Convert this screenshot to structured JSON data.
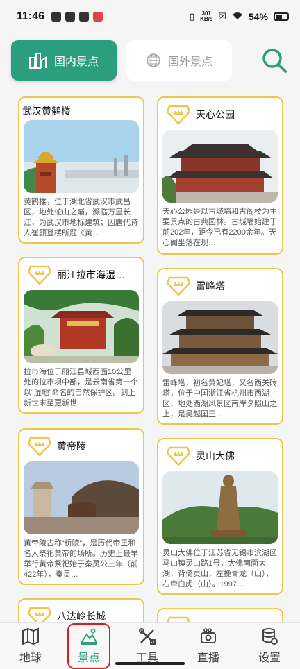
{
  "status": {
    "time": "11:46",
    "net_speed_value": "301",
    "net_speed_unit": "KB/s",
    "battery": "54%"
  },
  "tabs": {
    "domestic": "国内景点",
    "foreign": "国外景点"
  },
  "cards": [
    {
      "title": "武汉黄鹤楼",
      "desc": "黄鹤楼，位于湖北省武汉市武昌区，地处蛇山之巅，濒临万里长江，为武汉市地标建筑；因唐代诗人崔颢登楼所题《黄…"
    },
    {
      "title": "天心公园",
      "desc": "天心公园是以古城墙和古阁楼为主要景点的古典园林。古城墙始建于前202年，距今已有2200余年。天心阁坐落在现…"
    },
    {
      "title": "丽江拉市海湿…",
      "desc": "拉市海位于丽江县城西面10公里处的拉市坝中部，是云南省第一个以“湿地”命名的自然保护区。到上新世末至更新世…"
    },
    {
      "title": "雷峰塔",
      "desc": "雷峰塔，初名黄妃塔，又名西关砖塔，位于中国浙江省杭州市西湖区，地处西湖风景区南岸夕照山之上，是吴越国王…"
    },
    {
      "title": "黄帝陵",
      "desc": "黄帝陵古称“桥陵”，是历代帝王和名人祭祀黄帝的场所。历史上最早举行黄帝祭祀始于秦灵公三年（前422年），秦灵…"
    },
    {
      "title": "灵山大佛",
      "desc": "灵山大佛位于江苏省无锡市滨湖区马山镇灵山路1号，大佛南面太湖，背倚灵山，左挽青龙（山），右牵白虎（山）。1997…"
    },
    {
      "title": "八达岭长城",
      "desc": ""
    }
  ],
  "nav": [
    {
      "label": "地球",
      "icon": "map-icon"
    },
    {
      "label": "景点",
      "icon": "mountain-icon"
    },
    {
      "label": "工具",
      "icon": "tools-icon"
    },
    {
      "label": "直播",
      "icon": "camera-icon"
    },
    {
      "label": "设置",
      "icon": "database-settings-icon"
    }
  ],
  "colors": {
    "accent": "#2a9e7f",
    "card_border": "#f0c64a",
    "nav_highlight": "#d42020"
  }
}
